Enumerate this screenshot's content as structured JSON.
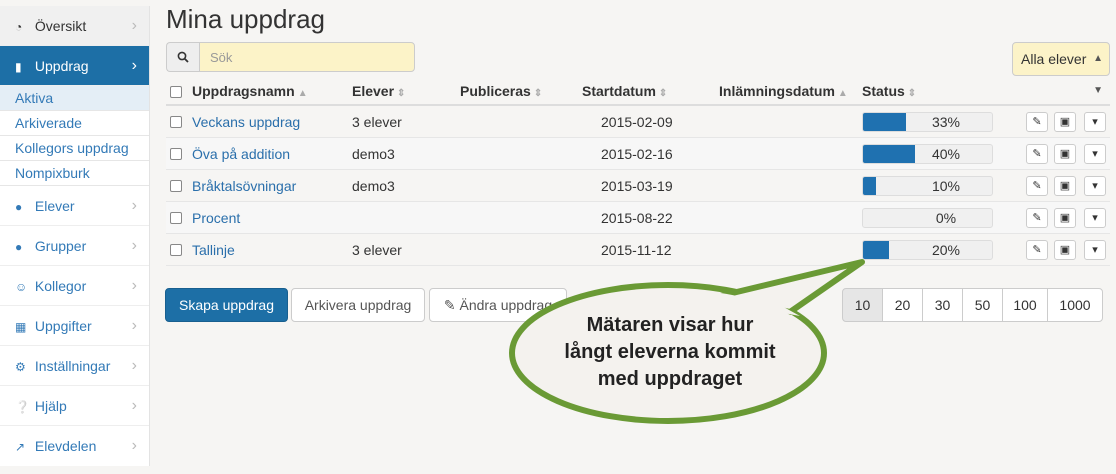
{
  "sidebar": {
    "items": [
      {
        "label": "Översikt"
      },
      {
        "label": "Uppdrag"
      },
      {
        "label": "Elever"
      },
      {
        "label": "Grupper"
      },
      {
        "label": "Kollegor"
      },
      {
        "label": "Uppgifter"
      },
      {
        "label": "Inställningar"
      },
      {
        "label": "Hjälp"
      },
      {
        "label": "Elevdelen"
      }
    ],
    "subitems": [
      {
        "label": "Aktiva"
      },
      {
        "label": "Arkiverade"
      },
      {
        "label": "Kollegors uppdrag"
      },
      {
        "label": "Nompixburk"
      }
    ]
  },
  "main": {
    "title": "Mina uppdrag",
    "search_placeholder": "Sök",
    "filter_value": "Alla elever"
  },
  "table": {
    "headers": {
      "name": "Uppdragsnamn",
      "students": "Elever",
      "published": "Publiceras",
      "start": "Startdatum",
      "due": "Inlämningsdatum",
      "status": "Status"
    },
    "rows": [
      {
        "name": "Veckans uppdrag",
        "students": "3 elever",
        "start": "2015-02-09",
        "progress": 0.33,
        "pct": "33%"
      },
      {
        "name": "Öva på addition",
        "students": "demo3",
        "start": "2015-02-16",
        "progress": 0.4,
        "pct": "40%"
      },
      {
        "name": "Bråktalsövningar",
        "students": "demo3",
        "start": "2015-03-19",
        "progress": 0.1,
        "pct": "10%"
      },
      {
        "name": "Procent",
        "students": "",
        "start": "2015-08-22",
        "progress": 0.0,
        "pct": "0%"
      },
      {
        "name": "Tallinje",
        "students": "3 elever",
        "start": "2015-11-12",
        "progress": 0.2,
        "pct": "20%"
      }
    ]
  },
  "buttons": {
    "create": "Skapa uppdrag",
    "archive": "Arkivera uppdrag",
    "edit": "Ändra uppdrag"
  },
  "pagination": [
    "10",
    "20",
    "30",
    "50",
    "100",
    "1000"
  ],
  "callout": {
    "line1": "Mätaren visar hur",
    "line2": "långt eleverna kommit",
    "line3": "med uppdraget"
  },
  "colors": {
    "accent": "#1d6fa6",
    "progress": "#1f71b0",
    "callout_border": "#6a9a35",
    "search_bg": "#fcf3c8"
  }
}
